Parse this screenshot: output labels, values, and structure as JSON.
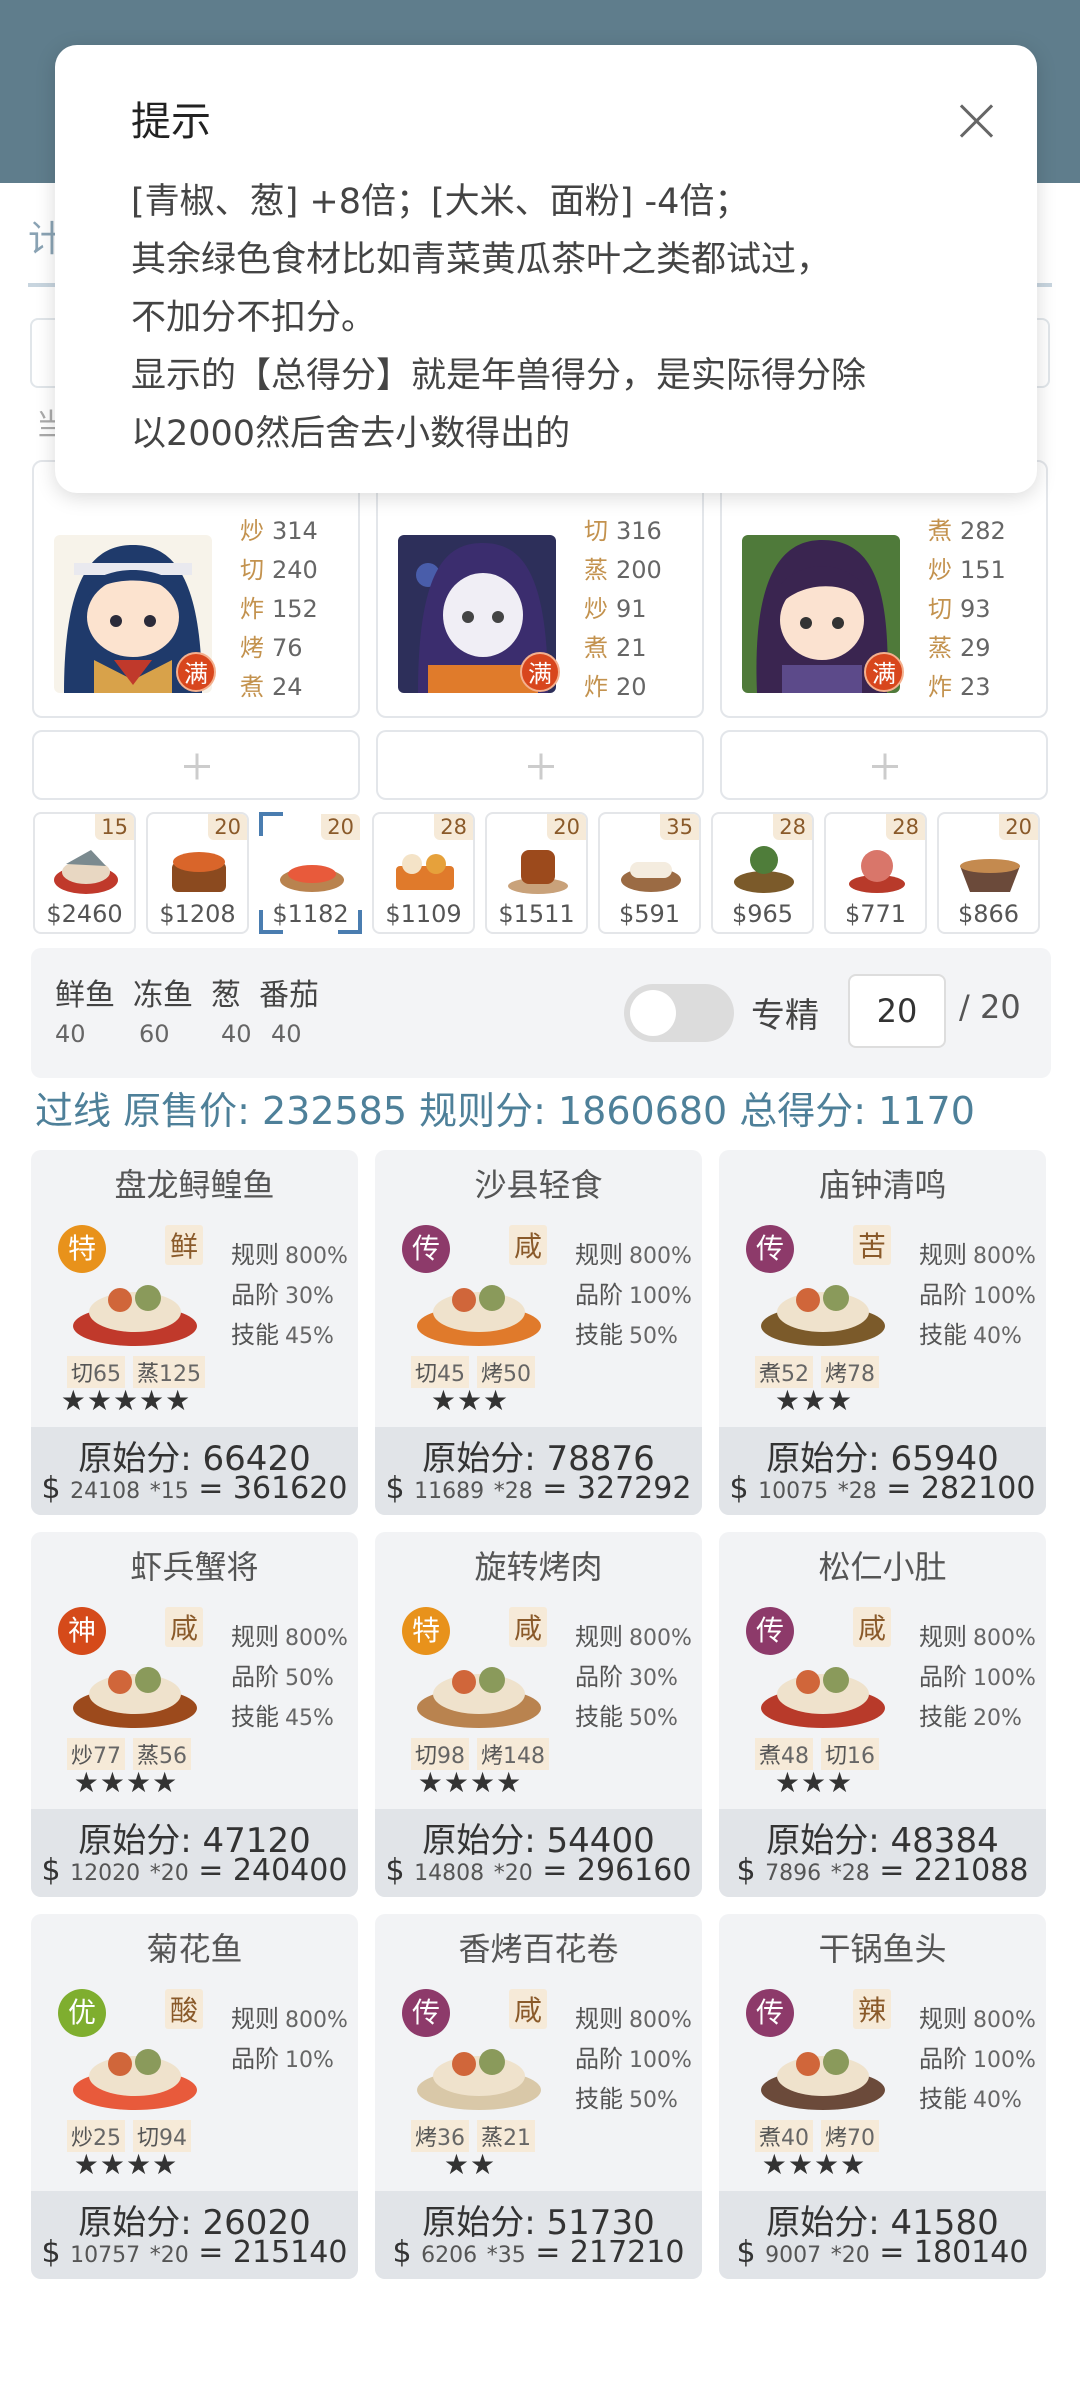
{
  "background": {
    "tab_char": "计",
    "hint_char": "当"
  },
  "dialog": {
    "title": "提示",
    "lines": [
      "[青椒、葱] +8倍；[大米、面粉] -4倍；",
      "其余绿色食材比如青菜黄瓜茶叶之类都试过，",
      "不加分不扣分。",
      "显示的【总得分】就是年兽得分，是实际得分除",
      "以2000然后舍去小数得出的"
    ]
  },
  "chefs": [
    {
      "badge": "满",
      "skills": [
        [
          "炒",
          "314"
        ],
        [
          "切",
          "240"
        ],
        [
          "炸",
          "152"
        ],
        [
          "烤",
          "76"
        ],
        [
          "煮",
          "24"
        ]
      ]
    },
    {
      "badge": "满",
      "skills": [
        [
          "切",
          "316"
        ],
        [
          "蒸",
          "200"
        ],
        [
          "炒",
          "91"
        ],
        [
          "煮",
          "21"
        ],
        [
          "炸",
          "20"
        ]
      ]
    },
    {
      "badge": "满",
      "skills": [
        [
          "煮",
          "282"
        ],
        [
          "炒",
          "151"
        ],
        [
          "切",
          "93"
        ],
        [
          "蒸",
          "29"
        ],
        [
          "炸",
          "23"
        ]
      ]
    }
  ],
  "dish_strip": [
    {
      "count": "15",
      "price": "$2460"
    },
    {
      "count": "20",
      "price": "$1208"
    },
    {
      "count": "20",
      "price": "$1182"
    },
    {
      "count": "28",
      "price": "$1109"
    },
    {
      "count": "20",
      "price": "$1511"
    },
    {
      "count": "35",
      "price": "$591"
    },
    {
      "count": "28",
      "price": "$965"
    },
    {
      "count": "28",
      "price": "$771"
    },
    {
      "count": "20",
      "price": "$866"
    }
  ],
  "ingredients": {
    "names": [
      "鲜鱼",
      "冻鱼",
      "葱",
      "番茄"
    ],
    "values": [
      "40",
      "60",
      "40",
      "40"
    ]
  },
  "mastery": {
    "label": "专精",
    "value": "20",
    "max": "/ 20"
  },
  "summary": "过线 原售价: 232585 规则分: 1860680 总得分: 1170",
  "labels": {
    "rule": "规则",
    "grade": "品阶",
    "skill": "技能",
    "orig": "原始分: "
  },
  "recipes": [
    {
      "name": "盘龙鲟鳇鱼",
      "grade": "特",
      "taste": "鲜",
      "rule": "800%",
      "grade_pct": "30%",
      "skill": "45%",
      "a1": "切",
      "a1v": "65",
      "a2": "蒸",
      "a2v": "125",
      "stars": "★★★★★",
      "orig": "66420",
      "price": "24108",
      "mult": "*15",
      "total": "361620"
    },
    {
      "name": "沙县轻食",
      "grade": "传",
      "taste": "咸",
      "rule": "800%",
      "grade_pct": "100%",
      "skill": "50%",
      "a1": "切",
      "a1v": "45",
      "a2": "烤",
      "a2v": "50",
      "stars": "★★★",
      "orig": "78876",
      "price": "11689",
      "mult": "*28",
      "total": "327292"
    },
    {
      "name": "庙钟清鸣",
      "grade": "传",
      "taste": "苦",
      "rule": "800%",
      "grade_pct": "100%",
      "skill": "40%",
      "a1": "煮",
      "a1v": "52",
      "a2": "烤",
      "a2v": "78",
      "stars": "★★★",
      "orig": "65940",
      "price": "10075",
      "mult": "*28",
      "total": "282100"
    },
    {
      "name": "虾兵蟹将",
      "grade": "神",
      "taste": "咸",
      "rule": "800%",
      "grade_pct": "50%",
      "skill": "45%",
      "a1": "炒",
      "a1v": "77",
      "a2": "蒸",
      "a2v": "56",
      "stars": "★★★★",
      "orig": "47120",
      "price": "12020",
      "mult": "*20",
      "total": "240400"
    },
    {
      "name": "旋转烤肉",
      "grade": "特",
      "taste": "咸",
      "rule": "800%",
      "grade_pct": "30%",
      "skill": "50%",
      "a1": "切",
      "a1v": "98",
      "a2": "烤",
      "a2v": "148",
      "stars": "★★★★",
      "orig": "54400",
      "price": "14808",
      "mult": "*20",
      "total": "296160"
    },
    {
      "name": "松仁小肚",
      "grade": "传",
      "taste": "咸",
      "rule": "800%",
      "grade_pct": "100%",
      "skill": "20%",
      "a1": "煮",
      "a1v": "48",
      "a2": "切",
      "a2v": "16",
      "stars": "★★★",
      "orig": "48384",
      "price": "7896",
      "mult": "*28",
      "total": "221088"
    },
    {
      "name": "菊花鱼",
      "grade": "优",
      "taste": "酸",
      "rule": "800%",
      "grade_pct": "10%",
      "skill": "",
      "a1": "炒",
      "a1v": "25",
      "a2": "切",
      "a2v": "94",
      "stars": "★★★★",
      "orig": "26020",
      "price": "10757",
      "mult": "*20",
      "total": "215140"
    },
    {
      "name": "香烤百花卷",
      "grade": "传",
      "taste": "咸",
      "rule": "800%",
      "grade_pct": "100%",
      "skill": "50%",
      "a1": "烤",
      "a1v": "36",
      "a2": "蒸",
      "a2v": "21",
      "stars": "★★",
      "orig": "51730",
      "price": "6206",
      "mult": "*35",
      "total": "217210"
    },
    {
      "name": "干锅鱼头",
      "grade": "传",
      "taste": "辣",
      "rule": "800%",
      "grade_pct": "100%",
      "skill": "40%",
      "a1": "煮",
      "a1v": "40",
      "a2": "烤",
      "a2v": "70",
      "stars": "★★★★",
      "orig": "41580",
      "price": "9007",
      "mult": "*20",
      "total": "180140"
    }
  ]
}
